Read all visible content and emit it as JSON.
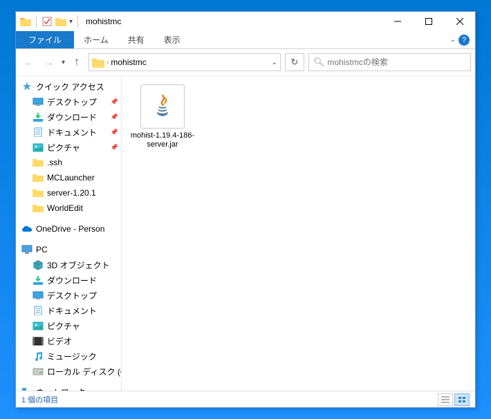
{
  "window": {
    "title": "mohistmc"
  },
  "ribbon": {
    "file": "ファイル",
    "home": "ホーム",
    "share": "共有",
    "view": "表示"
  },
  "address": {
    "segment": "mohistmc"
  },
  "search": {
    "placeholder": "mohistmcの検索"
  },
  "nav": {
    "quick_access": "クイック アクセス",
    "quick_items": [
      {
        "label": "デスクトップ",
        "icon": "desktop",
        "pinned": true
      },
      {
        "label": "ダウンロード",
        "icon": "download",
        "pinned": true
      },
      {
        "label": "ドキュメント",
        "icon": "document",
        "pinned": true
      },
      {
        "label": "ピクチャ",
        "icon": "pictures",
        "pinned": true
      },
      {
        "label": ".ssh",
        "icon": "folder",
        "pinned": false
      },
      {
        "label": "MCLauncher",
        "icon": "folder",
        "pinned": false
      },
      {
        "label": "server-1.20.1",
        "icon": "folder",
        "pinned": false
      },
      {
        "label": "WorldEdit",
        "icon": "folder",
        "pinned": false
      }
    ],
    "onedrive": "OneDrive - Person",
    "pc": "PC",
    "pc_items": [
      {
        "label": "3D オブジェクト",
        "icon": "3d"
      },
      {
        "label": "ダウンロード",
        "icon": "download"
      },
      {
        "label": "デスクトップ",
        "icon": "desktop"
      },
      {
        "label": "ドキュメント",
        "icon": "document"
      },
      {
        "label": "ピクチャ",
        "icon": "pictures"
      },
      {
        "label": "ビデオ",
        "icon": "video"
      },
      {
        "label": "ミュージック",
        "icon": "music"
      },
      {
        "label": "ローカル ディスク (C",
        "icon": "disk"
      }
    ],
    "network": "ネットワーク"
  },
  "files": [
    {
      "name": "mohist-1.19.4-186-server.jar",
      "type": "jar"
    }
  ],
  "status": {
    "count": "1 個の項目"
  }
}
